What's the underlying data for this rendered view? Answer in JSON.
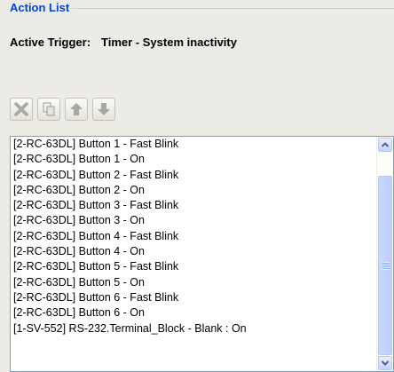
{
  "panel": {
    "title": "Action List",
    "trigger_label": "Active Trigger:",
    "trigger_value": "Timer - System inactivity"
  },
  "toolbar": {
    "buttons": [
      {
        "name": "delete",
        "icon": "x-delete-icon"
      },
      {
        "name": "copy",
        "icon": "copy-pages-icon"
      },
      {
        "name": "move-up",
        "icon": "arrow-up-icon"
      },
      {
        "name": "move-down",
        "icon": "arrow-down-icon"
      }
    ]
  },
  "action_list": {
    "items": [
      "[2-RC-63DL] Button 1 - Fast Blink",
      "[2-RC-63DL] Button 1 - On",
      "[2-RC-63DL] Button 2 - Fast Blink",
      "[2-RC-63DL] Button 2 - On",
      "[2-RC-63DL] Button 3 - Fast Blink",
      "[2-RC-63DL] Button 3 - On",
      "[2-RC-63DL] Button 4 - Fast Blink",
      "[2-RC-63DL] Button 4 - On",
      "[2-RC-63DL] Button 5 - Fast Blink",
      "[2-RC-63DL] Button 5 - On",
      "[2-RC-63DL] Button 6 - Fast Blink",
      "[2-RC-63DL] Button 6 - On",
      "[1-SV-552] RS-232.Terminal_Block - Blank : On"
    ]
  },
  "colors": {
    "title": "#0046d5",
    "background": "#ecebe6",
    "list_border": "#7f9db9",
    "scrollbar": "#c3d3fd"
  }
}
